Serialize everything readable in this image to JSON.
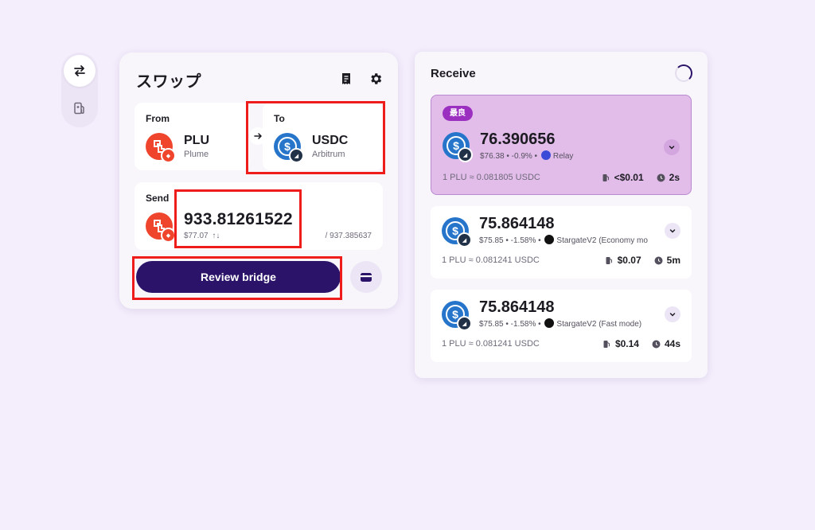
{
  "rail": {
    "items": [
      {
        "name": "swap",
        "active": true
      },
      {
        "name": "gas",
        "active": false
      }
    ]
  },
  "swap": {
    "title": "スワップ",
    "from": {
      "label": "From",
      "symbol": "PLU",
      "chain": "Plume"
    },
    "to": {
      "label": "To",
      "symbol": "USDC",
      "chain": "Arbitrum"
    },
    "send": {
      "label": "Send",
      "amount": "933.81261522",
      "usd": "$77.07",
      "swap_glyph": "↑↓",
      "balance": "/ 937.385637"
    },
    "review_button": "Review bridge"
  },
  "receive": {
    "title": "Receive",
    "quotes": [
      {
        "badge": "最良",
        "amount": "76.390656",
        "usd": "$76.38",
        "change": "-0.9%",
        "provider": "Relay",
        "rate": "1 PLU ≈ 0.081805 USDC",
        "fee": "<$0.01",
        "time": "2s",
        "best": true
      },
      {
        "amount": "75.864148",
        "usd": "$75.85",
        "change": "-1.58%",
        "provider": "StargateV2 (Economy mo",
        "rate": "1 PLU ≈ 0.081241 USDC",
        "fee": "$0.07",
        "time": "5m",
        "best": false
      },
      {
        "amount": "75.864148",
        "usd": "$75.85",
        "change": "-1.58%",
        "provider": "StargateV2 (Fast mode)",
        "rate": "1 PLU ≈ 0.081241 USDC",
        "fee": "$0.14",
        "time": "44s",
        "best": false
      }
    ]
  },
  "colors": {
    "background": "#f3edfc",
    "primary_button": "#2a1368",
    "best_quote": "#e2bdea",
    "best_badge": "#9b2fc0",
    "plume": "#f0452d",
    "usdc": "#2775ca",
    "highlight": "#ef1c1c"
  }
}
